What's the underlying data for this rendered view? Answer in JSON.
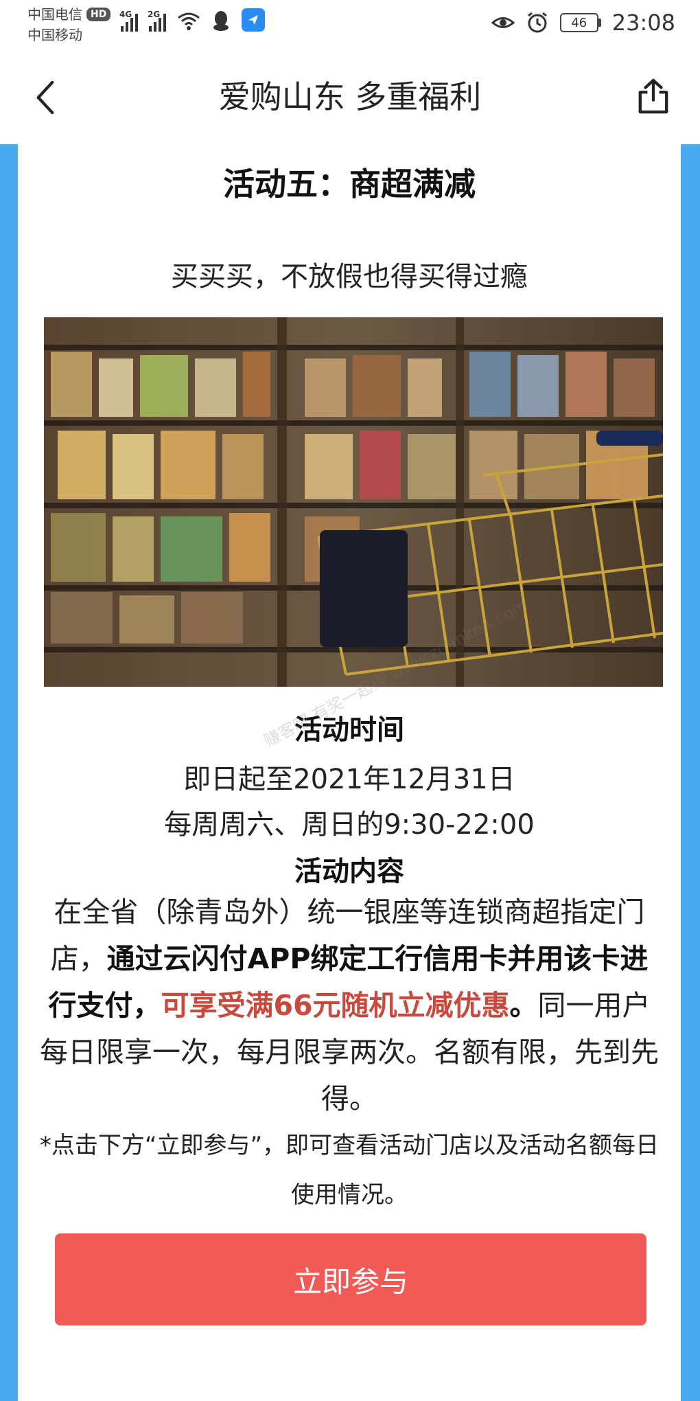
{
  "status_bar": {
    "carrier_1": "中国电信",
    "hd_badge": "HD",
    "carrier_2": "中国移动",
    "net_1": "4G",
    "net_2": "2G",
    "battery": "46",
    "time": "23:08"
  },
  "nav": {
    "title": "爱购山东 多重福利"
  },
  "activity": {
    "title": "活动五：商超满减",
    "subtitle": "买买买，不放假也得买得过瘾",
    "time_heading": "活动时间",
    "time_line1": "即日起至2021年12月31日",
    "time_line2": "每周周六、周日的9:30-22:00",
    "content_heading": "活动内容",
    "content_part1": "在全省（除青岛外）统一银座等连锁商超指定门店，",
    "content_bold": "通过云闪付APP绑定工行信用卡并用该卡进行支付，",
    "content_red": "可享受满66元随机立减优惠",
    "content_period": "。",
    "content_part2": "同一用户每日限享一次，每月限享两次。名额有限，先到先得。",
    "note": "*点击下方“立即参与”，即可查看活动门店以及活动名额每日使用情况。",
    "join_label": "立即参与"
  },
  "watermark": "赚客吧 有奖一起赚 www.zuanke8.com",
  "colors": {
    "frame_blue": "#4aaaf0",
    "button_red": "#f25a55",
    "highlight_red": "#c84a3e"
  }
}
